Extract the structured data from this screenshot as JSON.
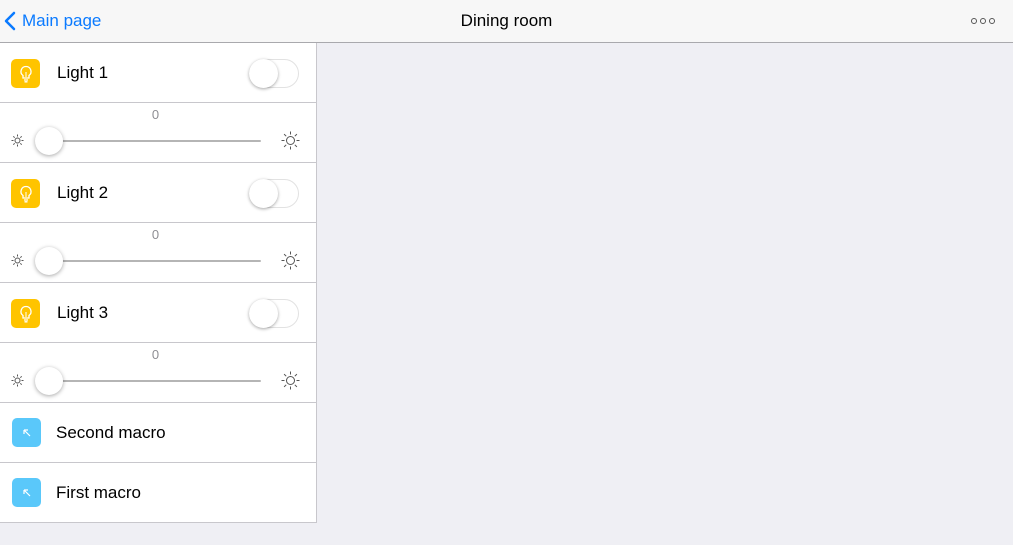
{
  "navbar": {
    "back_label": "Main page",
    "title": "Dining room",
    "more_icon": "more-icon"
  },
  "lights": [
    {
      "label": "Light 1",
      "on": false,
      "level_label": "0",
      "level": 0
    },
    {
      "label": "Light 2",
      "on": false,
      "level_label": "0",
      "level": 0
    },
    {
      "label": "Light 3",
      "on": false,
      "level_label": "0",
      "level": 0
    }
  ],
  "macros": [
    {
      "label": "Second macro"
    },
    {
      "label": "First macro"
    }
  ],
  "colors": {
    "accent": "#0a7aff",
    "bulb_icon_bg": "#ffc400",
    "macro_icon_bg": "#5ac8fa",
    "background": "#efeff4"
  }
}
